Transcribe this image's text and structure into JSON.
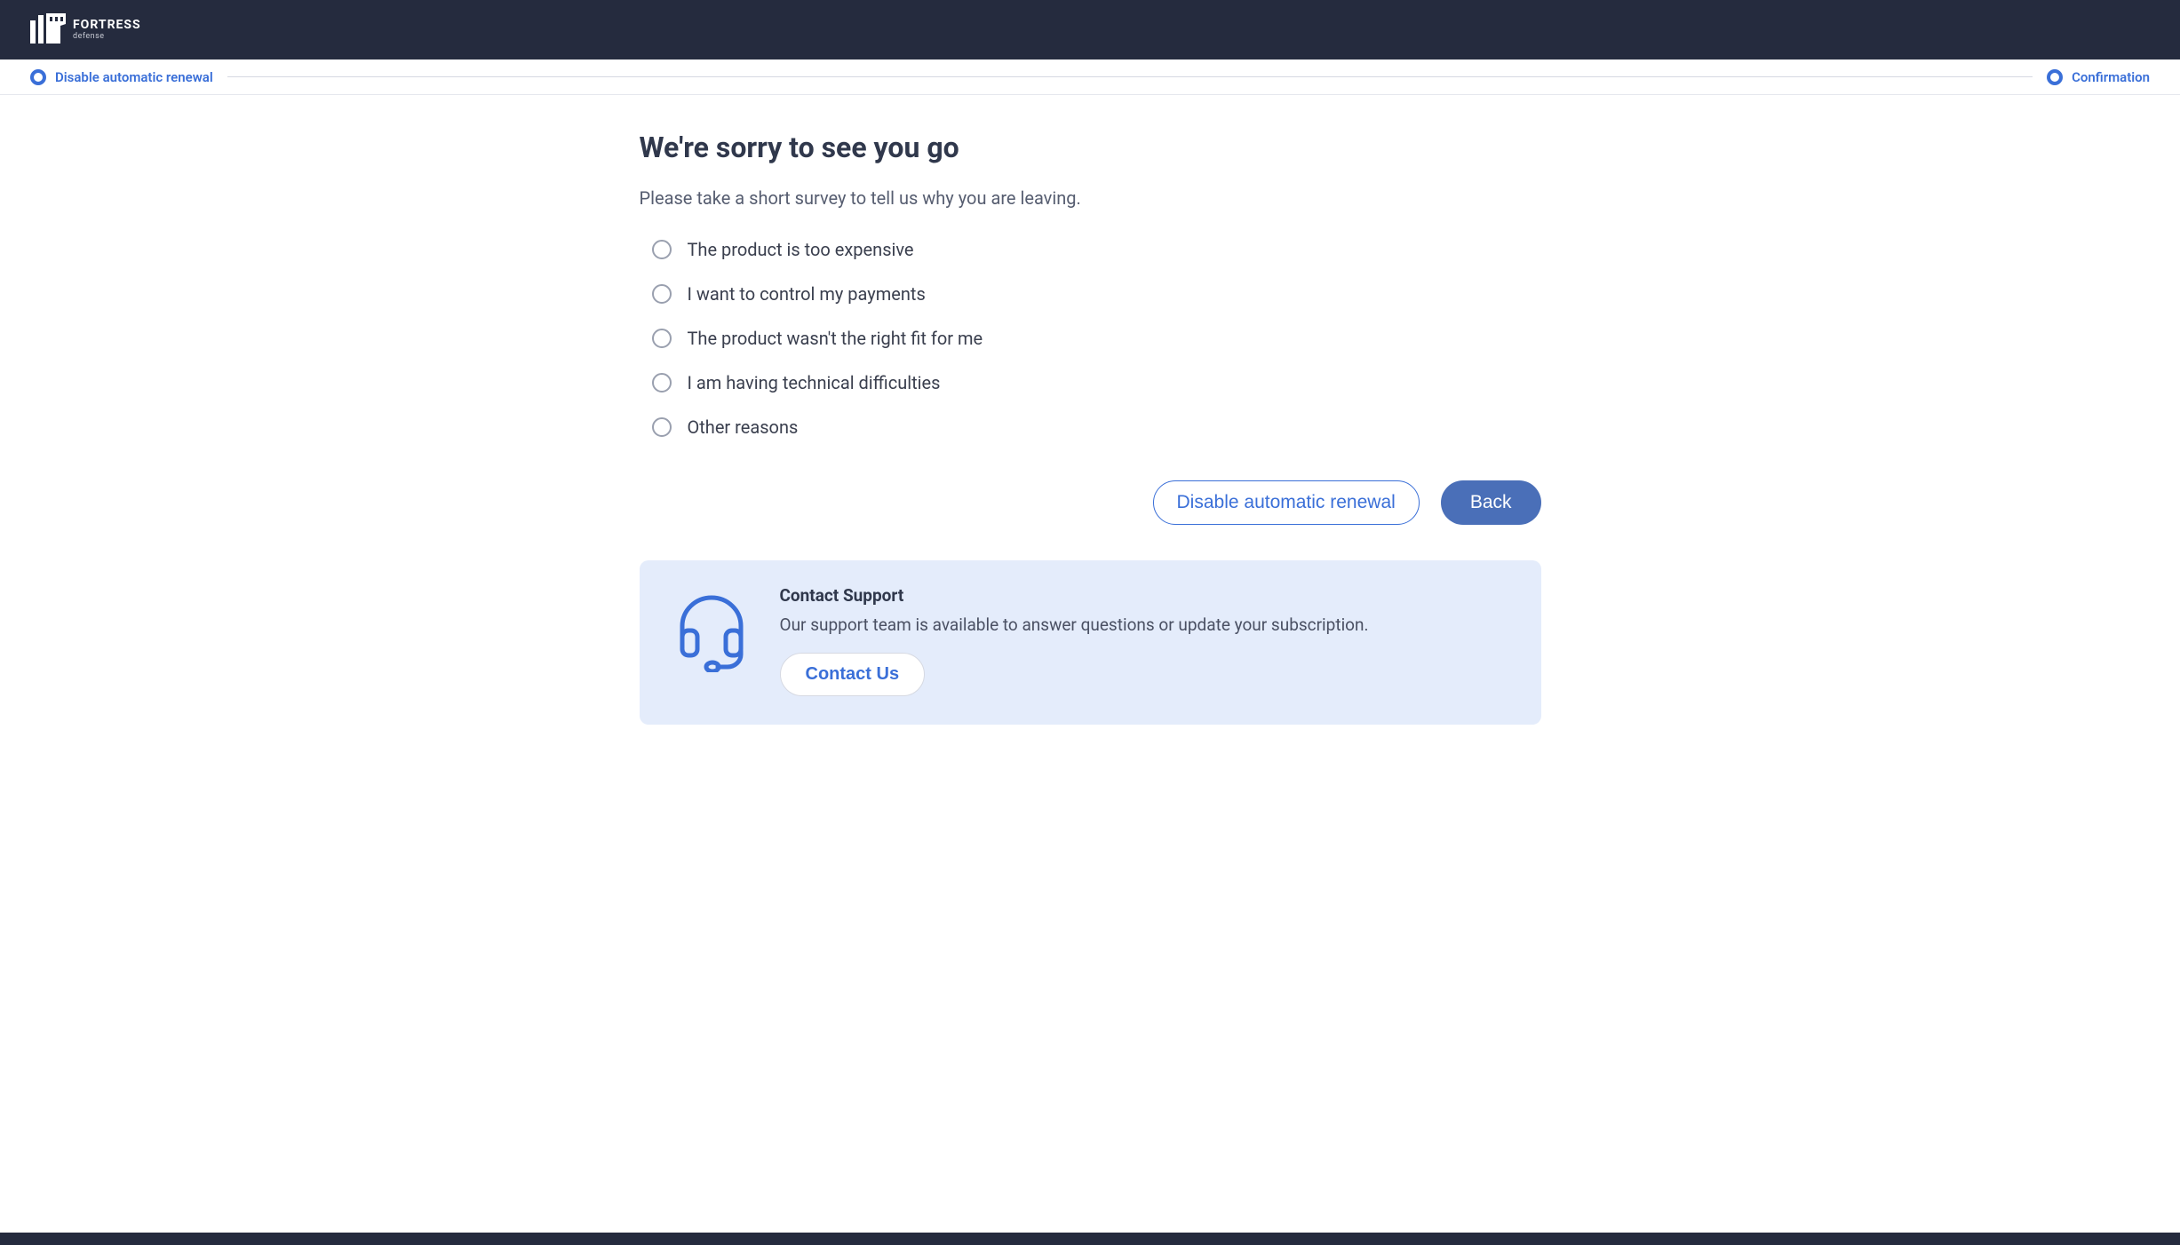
{
  "brand": {
    "name": "FORTRESS",
    "sub": "defense"
  },
  "progress": {
    "step1": "Disable automatic renewal",
    "step2": "Confirmation"
  },
  "page": {
    "title": "We're sorry to see you go",
    "subtitle": "Please take a short survey to tell us why you are leaving."
  },
  "options": [
    "The product is too expensive",
    "I want to control my payments",
    "The product wasn't the right fit for me",
    "I am having technical difficulties",
    "Other reasons"
  ],
  "actions": {
    "disable": "Disable automatic renewal",
    "back": "Back"
  },
  "support": {
    "title": "Contact Support",
    "text": "Our support team is available to answer questions or update your subscription.",
    "button": "Contact Us"
  }
}
